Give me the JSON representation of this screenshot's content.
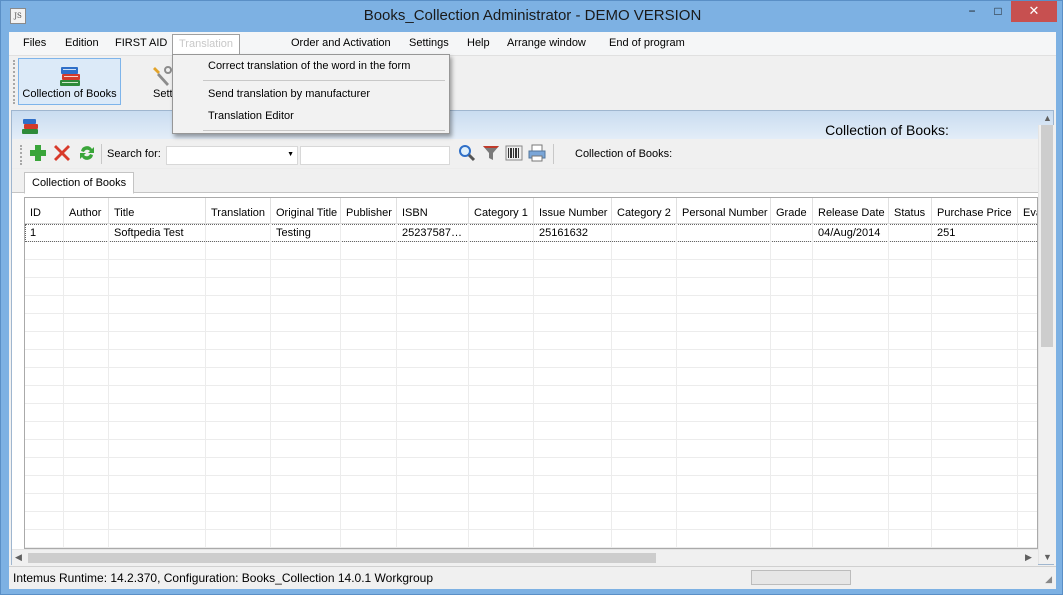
{
  "window": {
    "app_icon": "JS",
    "title": "Books_Collection  Administrator - DEMO VERSION",
    "minimize": "−",
    "maximize": "□",
    "close": "✕"
  },
  "menubar": {
    "items": [
      "Files",
      "Edition",
      "FIRST AID",
      "Translation",
      "Order and Activation",
      "Settings",
      "Help",
      "Arrange window",
      "End of program"
    ]
  },
  "toolbar": {
    "collection_label": "Collection of Books",
    "settings_label": "Sett"
  },
  "dropdown": {
    "items": [
      "Correct translation of the word in the form",
      "Send translation by manufacturer",
      "Translation Editor"
    ]
  },
  "mdi": {
    "title": "Collection of Books:",
    "search_label": "Search for:",
    "search_value": "",
    "search_text": "",
    "combo_arrow": "▼",
    "context_label": "Collection of Books:",
    "tab_label": "Collection of Books"
  },
  "grid": {
    "columns": [
      "ID",
      "Author",
      "Title",
      "Translation",
      "Original Title",
      "Publisher",
      "ISBN",
      "Category 1",
      "Issue Number",
      "Category 2",
      "Personal Number",
      "Grade",
      "Release Date",
      "Status",
      "Purchase Price",
      "Eva"
    ],
    "rows": [
      [
        "1",
        "",
        "Softpedia Test",
        "",
        "Testing",
        "",
        "25237587…",
        "",
        "25161632",
        "",
        "",
        "",
        "04/Aug/2014",
        "",
        "251",
        ""
      ]
    ]
  },
  "scroll": {
    "up": "▲",
    "down": "▼",
    "left": "◀",
    "right": "▶"
  },
  "status": {
    "text": "Intemus Runtime: 14.2.370,  Configuration: Books_Collection 14.0.1 Workgroup",
    "grip": "◢"
  },
  "icons": {
    "add": "add-icon",
    "delete": "delete-icon",
    "refresh": "refresh-icon",
    "search": "search-icon",
    "filter": "filter-icon",
    "barcode": "barcode-icon",
    "print": "print-icon"
  },
  "colors": {
    "title_bar": "#7db1e3",
    "close_button": "#c75050",
    "selection": "#dceaf8",
    "add_green": "#3aa53a",
    "delete_red": "#d83a2e"
  }
}
